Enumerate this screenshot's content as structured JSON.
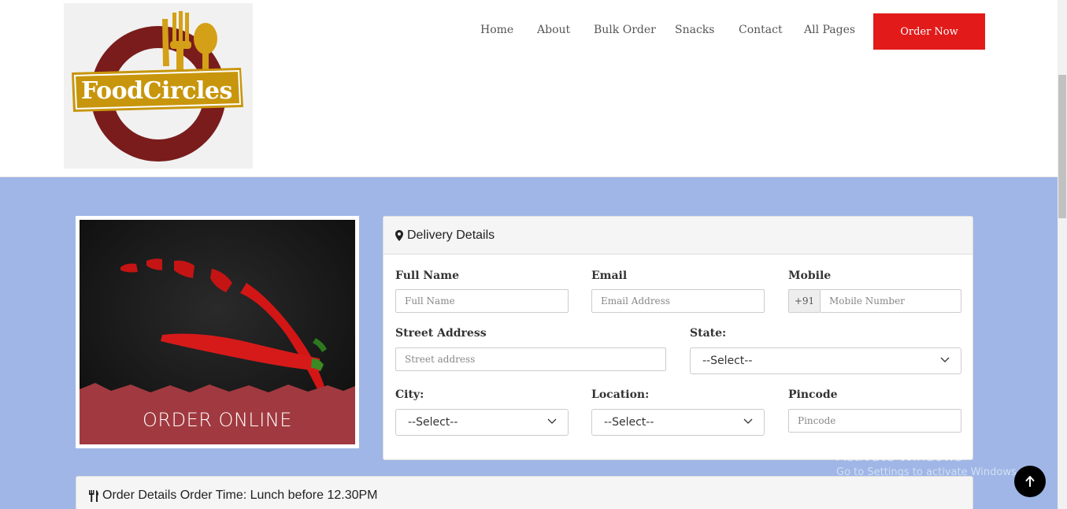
{
  "brand": {
    "name": "FoodCircles"
  },
  "nav": {
    "items": [
      "Home",
      "About",
      "Bulk Order",
      "Snacks",
      "Contact",
      "All Pages"
    ],
    "order_now": "Order Now"
  },
  "promo": {
    "text": "ORDER ONLINE"
  },
  "delivery": {
    "title": "Delivery Details",
    "full_name": {
      "label": "Full Name",
      "placeholder": "Full Name"
    },
    "email": {
      "label": "Email",
      "placeholder": "Email Address"
    },
    "mobile": {
      "label": "Mobile",
      "prefix": "+91",
      "placeholder": "Mobile Number"
    },
    "street": {
      "label": "Street Address",
      "placeholder": "Street address"
    },
    "state": {
      "label": "State:",
      "value": "--Select--"
    },
    "city": {
      "label": "City:",
      "value": "--Select--"
    },
    "location": {
      "label": "Location:",
      "value": "--Select--"
    },
    "pincode": {
      "label": "Pincode",
      "placeholder": "Pincode"
    }
  },
  "order_details": {
    "title": "Order Details Order Time: Lunch before 12.30PM"
  },
  "watermark": {
    "line1": "Activate Windows",
    "line2": "Go to Settings to activate Windows."
  },
  "colors": {
    "accent": "#e21a1a",
    "background": "#9fb6e6",
    "promo_band": "#a13a40"
  },
  "icons": {
    "delivery": "map-marker-icon",
    "order": "cutlery-icon",
    "back_to_top": "arrow-up-icon"
  }
}
